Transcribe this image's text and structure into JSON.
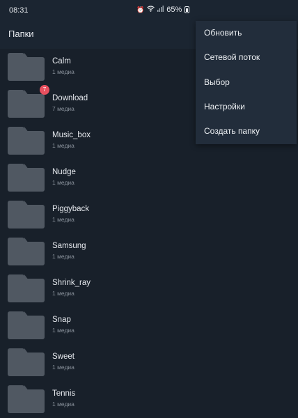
{
  "status_bar": {
    "time": "08:31",
    "battery": "65%",
    "icons": [
      "alarm-icon",
      "wifi-icon",
      "signal-icon",
      "battery-icon"
    ]
  },
  "app_bar": {
    "title": "Папки"
  },
  "folders": [
    {
      "name": "Calm",
      "count": "1 медиа"
    },
    {
      "name": "Download",
      "count": "7 медиа",
      "badge": "7"
    },
    {
      "name": "Music_box",
      "count": "1 медиа"
    },
    {
      "name": "Nudge",
      "count": "1 медиа"
    },
    {
      "name": "Piggyback",
      "count": "1 медиа"
    },
    {
      "name": "Samsung",
      "count": "1 медиа"
    },
    {
      "name": "Shrink_ray",
      "count": "1 медиа"
    },
    {
      "name": "Snap",
      "count": "1 медиа"
    },
    {
      "name": "Sweet",
      "count": "1 медиа"
    },
    {
      "name": "Tennis",
      "count": "1 медиа"
    }
  ],
  "menu": {
    "items": [
      "Обновить",
      "Сетевой поток",
      "Выбор",
      "Настройки",
      "Создать папку"
    ]
  },
  "colors": {
    "background": "#18202a",
    "folder": "#505862",
    "badge": "#e8505f",
    "menu": "#222d3b"
  }
}
